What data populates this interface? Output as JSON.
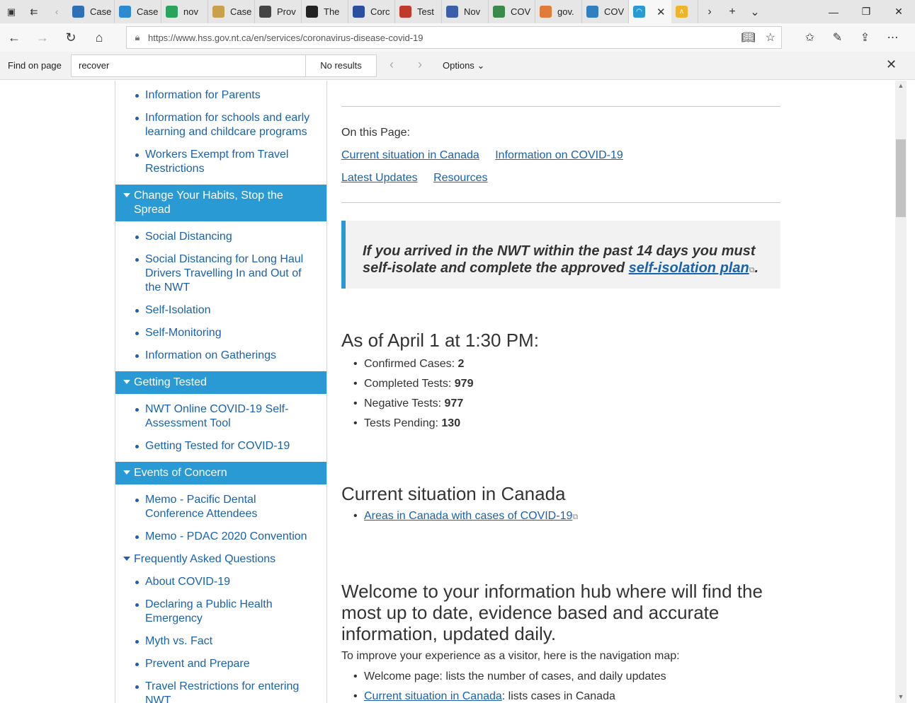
{
  "browser": {
    "tabs": [
      {
        "label": "Case",
        "color": "#2f6fb5"
      },
      {
        "label": "Case",
        "color": "#2b8ad1"
      },
      {
        "label": "nov",
        "color": "#2aa35c"
      },
      {
        "label": "Case",
        "color": "#c9a14a"
      },
      {
        "label": "Prov",
        "color": "#444444"
      },
      {
        "label": "The",
        "color": "#222222"
      },
      {
        "label": "Corc",
        "color": "#2a4fa0"
      },
      {
        "label": "Test",
        "color": "#c0392b"
      },
      {
        "label": "Nov",
        "color": "#3a5fa8"
      },
      {
        "label": "COV",
        "color": "#3a8a4a"
      },
      {
        "label": "gov.",
        "color": "#e07b39"
      },
      {
        "label": "COV",
        "color": "#2f7fc1"
      }
    ],
    "active_tab_close": "✕",
    "url": "https://www.hss.gov.nt.ca/en/services/coronavirus-disease-covid-19"
  },
  "find": {
    "label": "Find on page",
    "query": "recover",
    "results": "No results",
    "options_label": "Options"
  },
  "sidebar": {
    "top_items": [
      "Information for Parents",
      "Information for schools and early learning and childcare programs",
      "Workers Exempt from Travel Restrictions"
    ],
    "section_habits": "Change Your Habits, Stop the Spread",
    "habits_items": [
      "Social Distancing",
      "Social Distancing for Long Haul Drivers Travelling In and Out of the NWT",
      "Self-Isolation",
      "Self-Monitoring",
      "Information on Gatherings"
    ],
    "section_testing": "Getting Tested",
    "testing_items": [
      "NWT Online COVID-19 Self-Assessment Tool",
      "Getting Tested for COVID-19"
    ],
    "section_events": "Events of Concern",
    "events_items": [
      "Memo - Pacific Dental Conference Attendees",
      "Memo - PDAC 2020 Convention"
    ],
    "section_faq": "Frequently Asked Questions",
    "faq_items": [
      "About COVID-19",
      "Declaring a Public Health Emergency",
      "Myth vs. Fact",
      "Prevent and Prepare",
      "Travel Restrictions for entering NWT"
    ]
  },
  "main": {
    "on_this_page_label": "On this Page:",
    "on_this_page_links": [
      "Current situation in Canada",
      "Information on COVID-19",
      "Latest Updates",
      "Resources"
    ],
    "notice_text": "If you arrived in the NWT within the past 14 days you must self-isolate and complete the approved ",
    "notice_link": "self-isolation plan",
    "notice_end": ".",
    "date_heading": "As of April 1 at 1:30 PM:",
    "stats": [
      {
        "label": "Confirmed Cases: ",
        "value": "2"
      },
      {
        "label": "Completed Tests: ",
        "value": "979"
      },
      {
        "label": "Negative Tests: ",
        "value": "977"
      },
      {
        "label": "Tests Pending: ",
        "value": "130"
      }
    ],
    "current_heading": "Current situation in Canada",
    "current_link": "Areas in Canada with  cases of COVID-19",
    "hub_heading": "Welcome to your information hub where will find the most up to date, evidence based and accurate information, updated daily.",
    "intro": "To improve your experience as a visitor, here is the navigation map:",
    "map_items": [
      {
        "link": "",
        "text": "Welcome page: lists the number of cases, and daily updates"
      },
      {
        "link": "Current situation in Canada",
        "text": ": lists cases in Canada"
      }
    ]
  }
}
